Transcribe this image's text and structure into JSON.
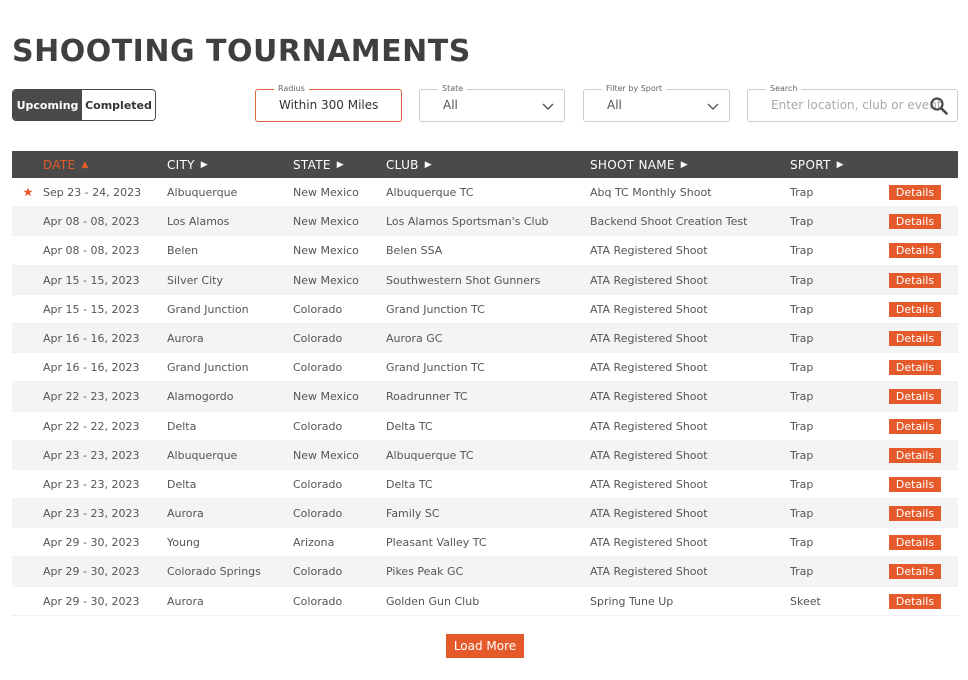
{
  "page": {
    "title": "SHOOTING TOURNAMENTS"
  },
  "toggle": {
    "upcoming": "Upcoming",
    "completed": "Completed",
    "active": "Upcoming"
  },
  "filters": {
    "radius": {
      "label": "Radius",
      "value": "Within 300 Miles"
    },
    "state": {
      "label": "State",
      "value": "All"
    },
    "sport": {
      "label": "Filter by Sport",
      "value": "All"
    },
    "search": {
      "label": "Search",
      "placeholder": "Enter location, club or event"
    }
  },
  "table": {
    "headers": {
      "date": "DATE",
      "city": "CITY",
      "state": "STATE",
      "club": "CLUB",
      "shoot_name": "SHOOT NAME",
      "sport": "SPORT"
    },
    "sorted_by": "date",
    "details_label": "Details",
    "rows": [
      {
        "starred": true,
        "date": "Sep 23 - 24, 2023",
        "city": "Albuquerque",
        "state": "New Mexico",
        "club": "Albuquerque TC",
        "shoot": "Abq TC Monthly Shoot",
        "sport": "Trap"
      },
      {
        "starred": false,
        "date": "Apr 08 - 08, 2023",
        "city": "Los Alamos",
        "state": "New Mexico",
        "club": "Los Alamos Sportsman's Club",
        "shoot": "Backend Shoot Creation Test",
        "sport": "Trap"
      },
      {
        "starred": false,
        "date": "Apr 08 - 08, 2023",
        "city": "Belen",
        "state": "New Mexico",
        "club": "Belen SSA",
        "shoot": "ATA Registered Shoot",
        "sport": "Trap"
      },
      {
        "starred": false,
        "date": "Apr 15 - 15, 2023",
        "city": "Silver City",
        "state": "New Mexico",
        "club": "Southwestern Shot Gunners",
        "shoot": "ATA Registered Shoot",
        "sport": "Trap"
      },
      {
        "starred": false,
        "date": "Apr 15 - 15, 2023",
        "city": "Grand Junction",
        "state": "Colorado",
        "club": "Grand Junction TC",
        "shoot": "ATA Registered Shoot",
        "sport": "Trap"
      },
      {
        "starred": false,
        "date": "Apr 16 - 16, 2023",
        "city": "Aurora",
        "state": "Colorado",
        "club": "Aurora GC",
        "shoot": "ATA Registered Shoot",
        "sport": "Trap"
      },
      {
        "starred": false,
        "date": "Apr 16 - 16, 2023",
        "city": "Grand Junction",
        "state": "Colorado",
        "club": "Grand Junction TC",
        "shoot": "ATA Registered Shoot",
        "sport": "Trap"
      },
      {
        "starred": false,
        "date": "Apr 22 - 23, 2023",
        "city": "Alamogordo",
        "state": "New Mexico",
        "club": "Roadrunner TC",
        "shoot": "ATA Registered Shoot",
        "sport": "Trap"
      },
      {
        "starred": false,
        "date": "Apr 22 - 22, 2023",
        "city": "Delta",
        "state": "Colorado",
        "club": "Delta TC",
        "shoot": "ATA Registered Shoot",
        "sport": "Trap"
      },
      {
        "starred": false,
        "date": "Apr 23 - 23, 2023",
        "city": "Albuquerque",
        "state": "New Mexico",
        "club": "Albuquerque TC",
        "shoot": "ATA Registered Shoot",
        "sport": "Trap"
      },
      {
        "starred": false,
        "date": "Apr 23 - 23, 2023",
        "city": "Delta",
        "state": "Colorado",
        "club": "Delta TC",
        "shoot": "ATA Registered Shoot",
        "sport": "Trap"
      },
      {
        "starred": false,
        "date": "Apr 23 - 23, 2023",
        "city": "Aurora",
        "state": "Colorado",
        "club": "Family SC",
        "shoot": "ATA Registered Shoot",
        "sport": "Trap"
      },
      {
        "starred": false,
        "date": "Apr 29 - 30, 2023",
        "city": "Young",
        "state": "Arizona",
        "club": "Pleasant Valley TC",
        "shoot": "ATA Registered Shoot",
        "sport": "Trap"
      },
      {
        "starred": false,
        "date": "Apr 29 - 30, 2023",
        "city": "Colorado Springs",
        "state": "Colorado",
        "club": "Pikes Peak GC",
        "shoot": "ATA Registered Shoot",
        "sport": "Trap"
      },
      {
        "starred": false,
        "date": "Apr 29 - 30, 2023",
        "city": "Aurora",
        "state": "Colorado",
        "club": "Golden Gun Club",
        "shoot": "Spring Tune Up",
        "sport": "Skeet"
      }
    ]
  },
  "load_more": "Load More",
  "colors": {
    "accent": "#e55a2b",
    "header_bg": "#4a4a4a"
  },
  "icons": {
    "star": "star-icon",
    "search": "search-icon",
    "chevron": "chevron-down-icon",
    "sort_up": "sort-up-icon",
    "sort_right": "caret-right-icon"
  }
}
